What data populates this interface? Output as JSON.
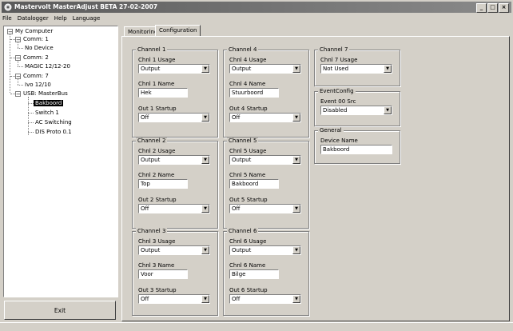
{
  "title": "Mastervolt MasterAdjust BETA 27-02-2007",
  "menu": [
    "File",
    "Datalogger",
    "Help",
    "Language"
  ],
  "tree": {
    "root": "My Computer",
    "comm1": "Comm: 1",
    "comm1_child": "No Device",
    "comm2": "Comm: 2",
    "comm2_child": "MAGIC 12/12-20",
    "comm7": "Comm: 7",
    "comm7_child": "Ivo 12/10",
    "usb": "USB: MasterBus",
    "usb_children": [
      "Bakboord",
      "Switch 1",
      "AC Switching",
      "DIS Proto 0.1"
    ]
  },
  "exit_label": "Exit",
  "tabs": [
    "Monitoring",
    "Configuration"
  ],
  "channels": [
    {
      "title": "Channel 1",
      "usage_label": "Chnl 1 Usage",
      "usage": "Output",
      "name_label": "Chnl 1 Name",
      "name": "Hek",
      "startup_label": "Out 1 Startup",
      "startup": "Off"
    },
    {
      "title": "Channel 2",
      "usage_label": "Chnl 2 Usage",
      "usage": "Output",
      "name_label": "Chnl 2 Name",
      "name": "Top",
      "startup_label": "Out 2 Startup",
      "startup": "Off"
    },
    {
      "title": "Channel 3",
      "usage_label": "Chnl 3 Usage",
      "usage": "Output",
      "name_label": "Chnl 3 Name",
      "name": "Voor",
      "startup_label": "Out 3 Startup",
      "startup": "Off"
    },
    {
      "title": "Channel 4",
      "usage_label": "Chnl 4 Usage",
      "usage": "Output",
      "name_label": "Chnl 4 Name",
      "name": "Stuurboord",
      "startup_label": "Out 4 Startup",
      "startup": "Off"
    },
    {
      "title": "Channel 5",
      "usage_label": "Chnl 5 Usage",
      "usage": "Output",
      "name_label": "Chnl 5 Name",
      "name": "Bakboord",
      "startup_label": "Out 5 Startup",
      "startup": "Off"
    },
    {
      "title": "Channel 6",
      "usage_label": "Chnl 6 Usage",
      "usage": "Output",
      "name_label": "Chnl 6 Name",
      "name": "Bilge",
      "startup_label": "Out 6 Startup",
      "startup": "Off"
    }
  ],
  "channel7": {
    "title": "Channel 7",
    "usage_label": "Chnl 7 Usage",
    "usage": "Not Used"
  },
  "eventconfig": {
    "title": "EventConfig",
    "src_label": "Event 00 Src",
    "src": "Disabled"
  },
  "general": {
    "title": "General",
    "device_label": "Device Name",
    "device": "Bakboord"
  },
  "window_buttons": {
    "minimize": "_",
    "maximize": "□",
    "close": "×"
  }
}
